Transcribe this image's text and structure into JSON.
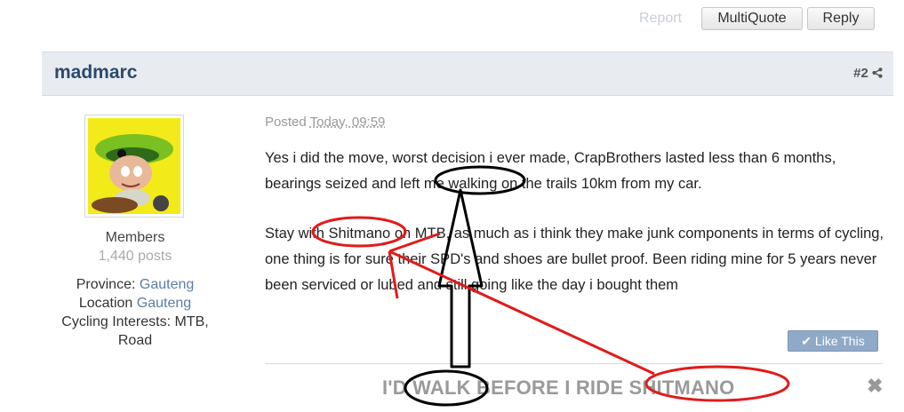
{
  "toolbar": {
    "report_label": "Report",
    "multiquote_label": "MultiQuote",
    "reply_label": "Reply"
  },
  "post": {
    "author": "madmarc",
    "number": "#2",
    "posted_label": "Posted",
    "posted_time": "Today, 09:59",
    "paragraph1": "Yes i did the move, worst decision i ever made, CrapBrothers lasted less than 6 months, bearings seized and left me walking on the trails 10km from my car.",
    "paragraph2": "Stay with Shitmano on MTB, as much as i think they make junk components in terms of cycling, one thing is for sure their SPD's and shoes are bullet proof. Been riding mine for 5 years never been serviced or lubed and still going like the day i bought them",
    "like_label": "Like This",
    "signature": "I'D WALK BEFORE I RIDE SHITMANO"
  },
  "user": {
    "group": "Members",
    "posts": "1,440 posts",
    "province_label": "Province:",
    "province": "Gauteng",
    "location_label": "Location",
    "location": "Gauteng",
    "interests_label": "Cycling Interests:",
    "interests": "MTB, Road"
  },
  "colors": {
    "annotation_red": "#e01b1b",
    "annotation_black": "#000000",
    "header_bg": "#e8ecf0",
    "author": "#2b4a6e"
  }
}
